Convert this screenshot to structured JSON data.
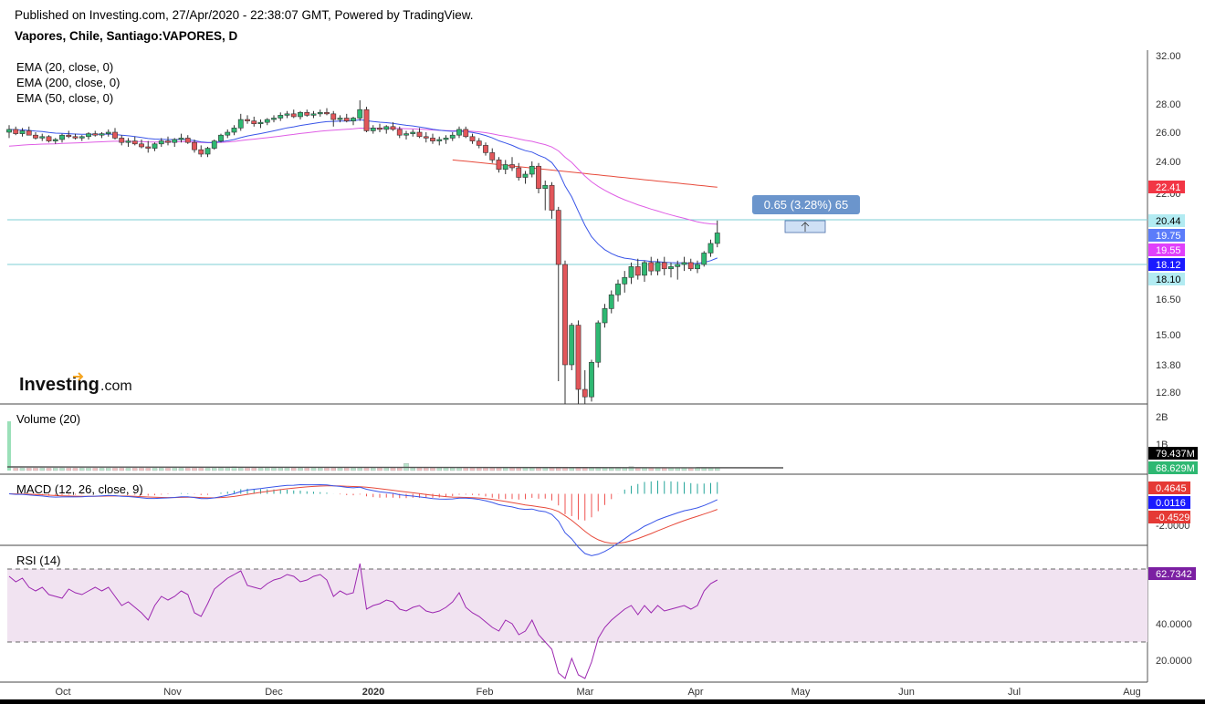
{
  "header": {
    "published": "Published on Investing.com, 27/Apr/2020 - 22:38:07 GMT, Powered by TradingView.",
    "symbol": "Vapores, Chile, Santiago:VAPORES, D"
  },
  "watermark": {
    "brand": "Investing",
    "suffix": ".com"
  },
  "legend": {
    "ema20": "EMA (20, close, 0)",
    "ema200": "EMA (200, close, 0)",
    "ema50": "EMA (50, close, 0)",
    "volume": "Volume (20)",
    "macd": "MACD (12, 26, close, 9)",
    "rsi": "RSI (14)"
  },
  "measure_tooltip": "0.65 (3.28%) 65",
  "colors": {
    "up": "#2eb872",
    "down": "#e2565a",
    "ema20": "#3955e8",
    "ema50": "#df5ee5",
    "ema200": "#e74a3b",
    "hline": "#7ccfd4",
    "rsi_fill": "#f1e3f1",
    "rsi_line": "#9c27b0"
  },
  "chart_data": [
    {
      "type": "candlestick",
      "name": "Price",
      "x_ticks": [
        "Oct",
        "Nov",
        "Dec",
        "2020",
        "Feb",
        "Mar",
        "Apr",
        "May",
        "Jun",
        "Jul",
        "Aug"
      ],
      "y_ticks": [
        "32.00",
        "28.00",
        "26.00",
        "24.00",
        "22.00",
        "16.50",
        "15.00",
        "13.80",
        "12.80"
      ],
      "ylim": [
        12.3,
        32.0
      ],
      "price_badges": [
        {
          "value": "22.41",
          "series": "ema200",
          "color": "#f23645"
        },
        {
          "value": "20.44",
          "series": "hline-top",
          "color": "#b2ebf2"
        },
        {
          "value": "19.75",
          "series": "ema20",
          "color": "#5b7cfa"
        },
        {
          "value": "19.55",
          "series": "ema50",
          "color": "#e040fb"
        },
        {
          "value": "18.12",
          "series": "last",
          "color": "#1a1aff"
        },
        {
          "value": "18.10",
          "series": "hline-bottom",
          "color": "#b2ebf2"
        }
      ],
      "horizontal_lines": [
        20.44,
        18.1
      ],
      "ohlc": [
        [
          26.0,
          26.5,
          25.6,
          26.2
        ],
        [
          26.2,
          26.4,
          25.8,
          25.9
        ],
        [
          25.9,
          26.3,
          25.7,
          26.1
        ],
        [
          26.1,
          26.4,
          25.8,
          25.8
        ],
        [
          25.8,
          26.0,
          25.5,
          25.6
        ],
        [
          25.6,
          25.9,
          25.4,
          25.7
        ],
        [
          25.7,
          25.8,
          25.3,
          25.4
        ],
        [
          25.4,
          25.6,
          25.2,
          25.5
        ],
        [
          25.5,
          25.9,
          25.3,
          25.8
        ],
        [
          25.8,
          26.1,
          25.6,
          25.7
        ],
        [
          25.7,
          25.9,
          25.5,
          25.6
        ],
        [
          25.6,
          25.8,
          25.4,
          25.7
        ],
        [
          25.7,
          26.0,
          25.5,
          25.9
        ],
        [
          25.9,
          26.1,
          25.7,
          25.8
        ],
        [
          25.8,
          26.0,
          25.6,
          25.9
        ],
        [
          25.9,
          26.2,
          25.7,
          26.0
        ],
        [
          26.0,
          26.3,
          25.5,
          25.6
        ],
        [
          25.6,
          25.8,
          25.1,
          25.3
        ],
        [
          25.3,
          25.6,
          25.0,
          25.4
        ],
        [
          25.4,
          25.7,
          25.1,
          25.2
        ],
        [
          25.2,
          25.5,
          24.9,
          25.0
        ],
        [
          25.0,
          25.4,
          24.6,
          24.9
        ],
        [
          24.9,
          25.3,
          24.7,
          25.2
        ],
        [
          25.2,
          25.6,
          25.0,
          25.4
        ],
        [
          25.4,
          25.7,
          25.1,
          25.3
        ],
        [
          25.3,
          25.6,
          25.0,
          25.5
        ],
        [
          25.5,
          25.9,
          25.3,
          25.6
        ],
        [
          25.6,
          25.8,
          25.2,
          25.3
        ],
        [
          25.3,
          25.5,
          24.6,
          24.8
        ],
        [
          24.8,
          25.1,
          24.3,
          24.5
        ],
        [
          24.5,
          25.0,
          24.3,
          24.9
        ],
        [
          24.9,
          25.5,
          24.8,
          25.4
        ],
        [
          25.4,
          25.9,
          25.3,
          25.8
        ],
        [
          25.8,
          26.2,
          25.6,
          26.0
        ],
        [
          26.0,
          26.5,
          25.8,
          26.3
        ],
        [
          26.3,
          27.3,
          26.1,
          26.9
        ],
        [
          26.9,
          27.2,
          26.6,
          26.8
        ],
        [
          26.8,
          27.1,
          26.4,
          26.6
        ],
        [
          26.6,
          26.9,
          26.3,
          26.7
        ],
        [
          26.7,
          27.0,
          26.5,
          26.9
        ],
        [
          26.9,
          27.2,
          26.7,
          27.0
        ],
        [
          27.0,
          27.4,
          26.8,
          27.2
        ],
        [
          27.2,
          27.5,
          27.0,
          27.3
        ],
        [
          27.3,
          27.6,
          27.0,
          27.1
        ],
        [
          27.1,
          27.5,
          26.9,
          27.4
        ],
        [
          27.4,
          27.6,
          27.1,
          27.2
        ],
        [
          27.2,
          27.5,
          27.0,
          27.3
        ],
        [
          27.3,
          27.6,
          27.1,
          27.4
        ],
        [
          27.4,
          27.7,
          27.2,
          27.3
        ],
        [
          27.3,
          27.5,
          26.4,
          26.9
        ],
        [
          26.9,
          27.2,
          26.7,
          27.0
        ],
        [
          27.0,
          27.3,
          26.7,
          26.8
        ],
        [
          26.8,
          27.1,
          26.5,
          27.0
        ],
        [
          27.0,
          28.3,
          26.8,
          27.6
        ],
        [
          27.6,
          27.8,
          26.0,
          26.1
        ],
        [
          26.1,
          26.5,
          25.9,
          26.3
        ],
        [
          26.3,
          26.6,
          26.0,
          26.2
        ],
        [
          26.2,
          26.5,
          25.9,
          26.4
        ],
        [
          26.4,
          26.7,
          26.1,
          26.2
        ],
        [
          26.2,
          26.4,
          25.6,
          25.8
        ],
        [
          25.8,
          26.1,
          25.5,
          25.9
        ],
        [
          25.9,
          26.2,
          25.7,
          26.0
        ],
        [
          26.0,
          26.3,
          25.6,
          25.7
        ],
        [
          25.7,
          26.0,
          25.3,
          25.6
        ],
        [
          25.6,
          25.9,
          25.2,
          25.4
        ],
        [
          25.4,
          25.7,
          25.1,
          25.5
        ],
        [
          25.5,
          25.8,
          25.2,
          25.6
        ],
        [
          25.6,
          26.0,
          25.4,
          25.8
        ],
        [
          25.8,
          26.4,
          25.6,
          26.2
        ],
        [
          26.2,
          26.4,
          25.6,
          25.7
        ],
        [
          25.7,
          25.9,
          25.2,
          25.4
        ],
        [
          25.4,
          25.6,
          24.9,
          25.1
        ],
        [
          25.1,
          25.3,
          24.4,
          24.6
        ],
        [
          24.6,
          24.9,
          23.9,
          24.1
        ],
        [
          24.1,
          24.3,
          23.3,
          23.5
        ],
        [
          23.5,
          24.1,
          23.2,
          23.8
        ],
        [
          23.8,
          24.3,
          23.4,
          23.6
        ],
        [
          23.6,
          23.9,
          22.8,
          23.0
        ],
        [
          23.0,
          23.4,
          22.6,
          23.2
        ],
        [
          23.2,
          24.0,
          23.0,
          23.7
        ],
        [
          23.7,
          23.9,
          22.0,
          22.3
        ],
        [
          22.3,
          22.8,
          21.0,
          22.5
        ],
        [
          22.5,
          22.7,
          20.5,
          21.0
        ],
        [
          21.0,
          21.2,
          13.2,
          18.1
        ],
        [
          18.1,
          18.3,
          12.3,
          13.8
        ],
        [
          13.8,
          15.5,
          13.6,
          15.4
        ],
        [
          15.4,
          15.6,
          12.3,
          12.9
        ],
        [
          12.9,
          13.6,
          12.3,
          12.6
        ],
        [
          12.6,
          14.0,
          12.4,
          13.9
        ],
        [
          13.9,
          15.6,
          13.7,
          15.5
        ],
        [
          15.5,
          16.3,
          15.3,
          16.1
        ],
        [
          16.1,
          16.9,
          15.9,
          16.7
        ],
        [
          16.7,
          17.4,
          16.4,
          17.2
        ],
        [
          17.2,
          17.8,
          16.8,
          17.5
        ],
        [
          17.5,
          18.2,
          17.2,
          18.0
        ],
        [
          18.0,
          18.4,
          17.4,
          17.6
        ],
        [
          17.6,
          18.3,
          17.3,
          18.2
        ],
        [
          18.2,
          18.5,
          17.6,
          17.8
        ],
        [
          17.8,
          18.4,
          17.6,
          18.2
        ],
        [
          18.2,
          18.5,
          17.6,
          17.9
        ],
        [
          17.9,
          18.2,
          17.5,
          18.0
        ],
        [
          18.0,
          18.3,
          17.4,
          18.1
        ],
        [
          18.1,
          18.5,
          17.8,
          18.2
        ],
        [
          18.2,
          18.4,
          17.8,
          17.9
        ],
        [
          17.9,
          18.3,
          17.7,
          18.1
        ],
        [
          18.1,
          18.8,
          18.0,
          18.7
        ],
        [
          18.7,
          19.4,
          18.5,
          19.2
        ],
        [
          19.2,
          20.4,
          19.0,
          19.75
        ]
      ],
      "ema20_start_index": 0,
      "ema200_start_index": 67
    },
    {
      "type": "bar",
      "name": "Volume (20)",
      "y_ticks": [
        "2B",
        "1B"
      ],
      "ylim": [
        0,
        2000
      ],
      "unit": "M",
      "badges": [
        {
          "value": "79.437M",
          "color": "#000000"
        },
        {
          "value": "68.629M",
          "color": "#2eb872"
        }
      ],
      "spike_first_bar_value": 1800,
      "typical_value": 70
    },
    {
      "type": "line",
      "name": "MACD (12, 26, close, 9)",
      "y_ticks": [
        "-2.0000"
      ],
      "ylim": [
        -2.6,
        0.9
      ],
      "badges": [
        {
          "value": "0.4645",
          "color": "#e53935"
        },
        {
          "value": "0.0116",
          "color": "#1a1aff"
        },
        {
          "value": "-0.4529",
          "color": "#e53935"
        }
      ],
      "series": [
        {
          "name": "MACD",
          "color": "#3955e8"
        },
        {
          "name": "Signal",
          "color": "#e74a3b"
        }
      ]
    },
    {
      "type": "line",
      "name": "RSI (14)",
      "y_ticks": [
        "40.0000",
        "20.0000"
      ],
      "ylim": [
        8,
        82
      ],
      "bands": [
        70,
        30
      ],
      "badges": [
        {
          "value": "62.7342",
          "color": "#7b1fa2"
        }
      ],
      "values": [
        66,
        63,
        65,
        60,
        58,
        60,
        56,
        55,
        54,
        59,
        57,
        56,
        58,
        60,
        58,
        60,
        55,
        50,
        52,
        49,
        46,
        42,
        50,
        55,
        53,
        55,
        58,
        56,
        46,
        44,
        51,
        59,
        62,
        65,
        67,
        69,
        61,
        60,
        59,
        62,
        64,
        65,
        67,
        66,
        63,
        64,
        66,
        67,
        64,
        55,
        58,
        56,
        57,
        73,
        48,
        50,
        51,
        53,
        52,
        48,
        47,
        49,
        50,
        47,
        46,
        47,
        49,
        52,
        57,
        49,
        46,
        44,
        41,
        38,
        36,
        42,
        40,
        34,
        36,
        42,
        34,
        30,
        26,
        13,
        10,
        21,
        12,
        10,
        19,
        32,
        38,
        42,
        45,
        48,
        50,
        45,
        50,
        46,
        50,
        47,
        48,
        49,
        50,
        48,
        50,
        58,
        62,
        64
      ]
    }
  ],
  "x_axis_labels": [
    "Oct",
    "Nov",
    "Dec",
    "2020",
    "Feb",
    "Mar",
    "Apr",
    "May",
    "Jun",
    "Jul",
    "Aug"
  ]
}
